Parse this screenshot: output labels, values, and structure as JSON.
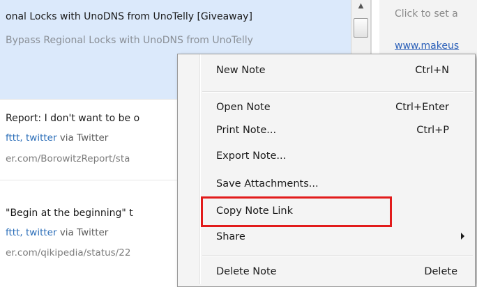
{
  "notes_list": {
    "rows": [
      {
        "title": "onal Locks with UnoDNS from UnoTelly [Giveaway]",
        "subtitle": "Bypass Regional Locks with UnoDNS from UnoTelly"
      },
      {
        "title": "Report: I don't want to be o",
        "tag1": "fttt,",
        "tag2": "twitter",
        "via": "via Twitter",
        "url": "er.com/BorowitzReport/sta"
      },
      {
        "title": "\"Begin at the beginning\" t",
        "tag1": "fttt,",
        "tag2": "twitter",
        "via": "via Twitter",
        "url": "er.com/qikipedia/status/22"
      }
    ]
  },
  "right_pane": {
    "click_to_set": "Click to set a",
    "link_text": "www.makeus"
  },
  "context_menu": {
    "items": [
      {
        "label": "New Note",
        "shortcut": "Ctrl+N"
      },
      {
        "label": "Open Note",
        "shortcut": "Ctrl+Enter"
      },
      {
        "label": "Print Note...",
        "shortcut": "Ctrl+P"
      },
      {
        "label": "Export Note...",
        "shortcut": ""
      },
      {
        "label": "Save Attachments...",
        "shortcut": ""
      },
      {
        "label": "Copy Note Link",
        "shortcut": ""
      },
      {
        "label": "Share",
        "shortcut": ""
      },
      {
        "label": "Delete Note",
        "shortcut": "Delete"
      }
    ]
  },
  "colors": {
    "selection": "#dbe9fb",
    "highlight_box": "#e21b1b",
    "link": "#2a6db8"
  },
  "icons": {
    "scroll_up": "chevron-up-icon",
    "submenu": "chevron-right-icon"
  }
}
